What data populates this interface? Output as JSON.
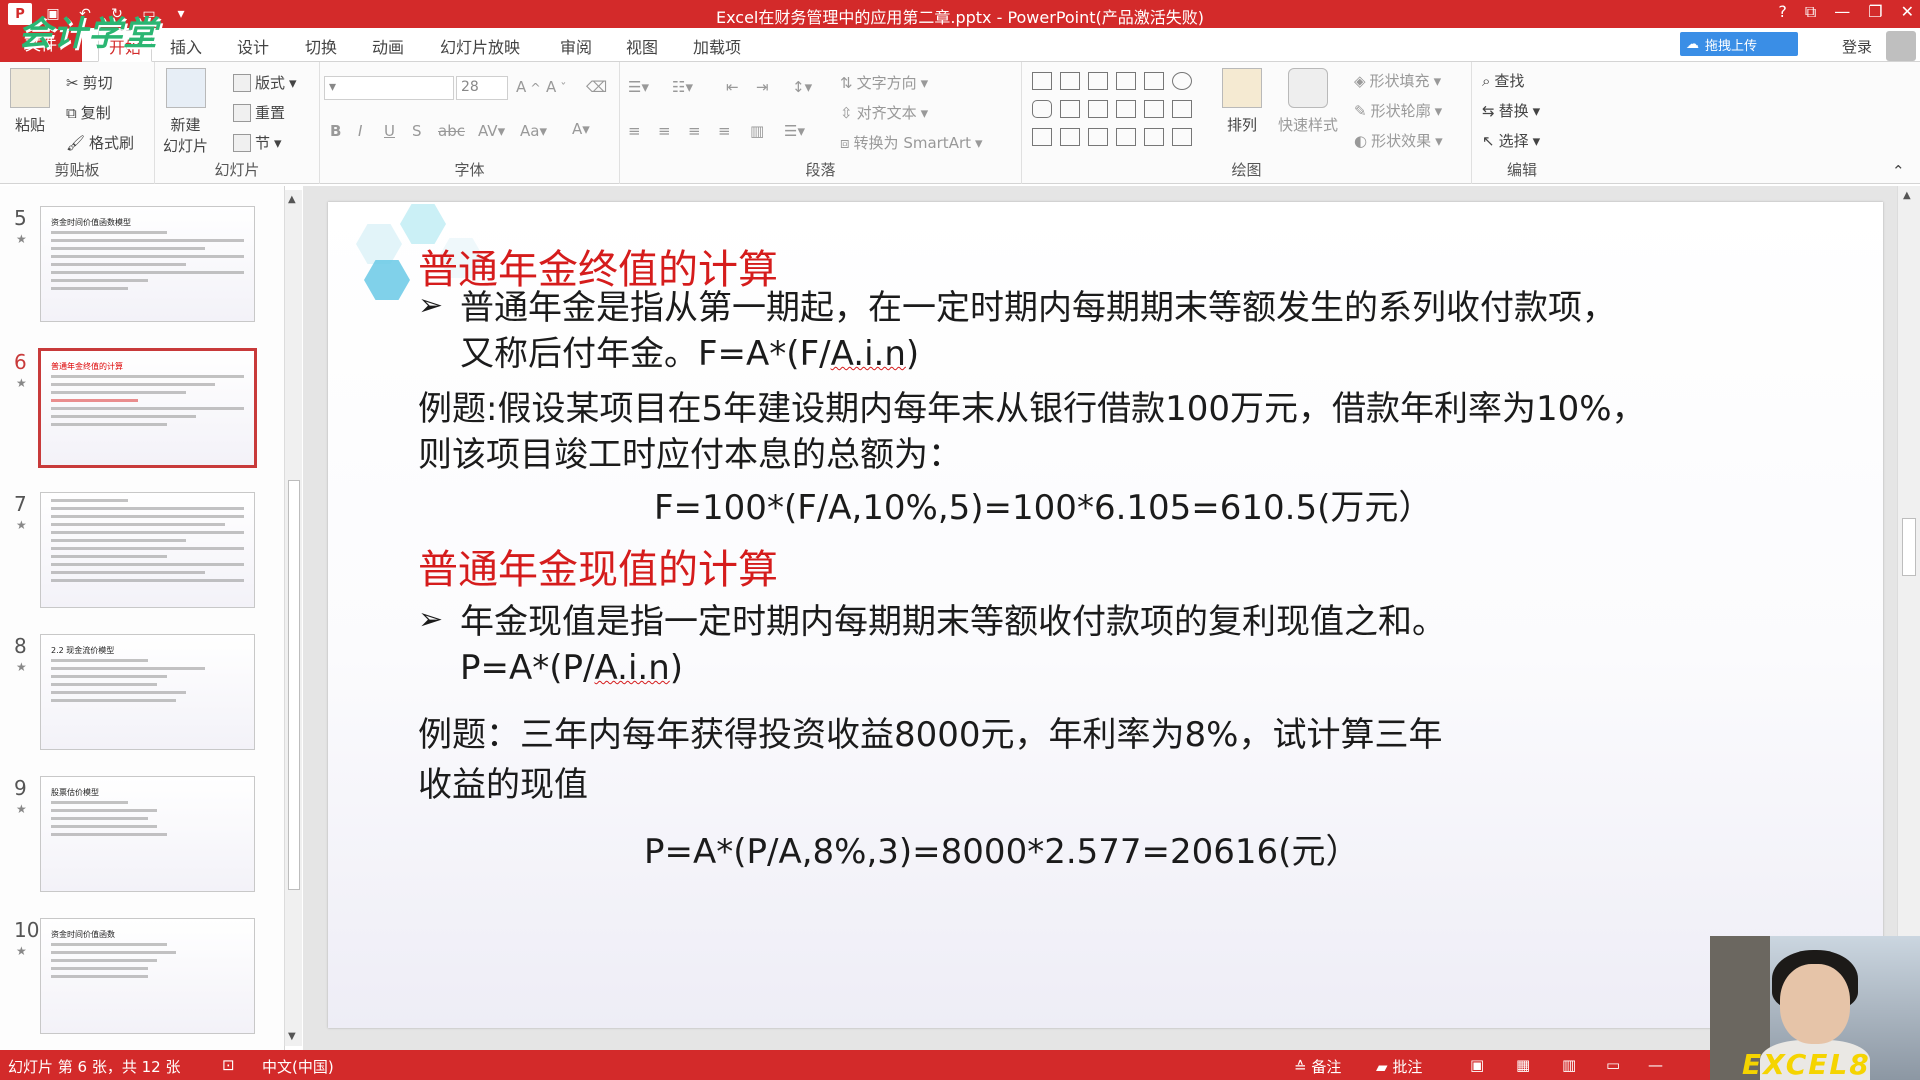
{
  "titlebar": {
    "title": "Excel在财务管理中的应用第二章.pptx - PowerPoint(产品激活失败)",
    "watermark": "会计学堂",
    "window_controls": [
      "?",
      "⧉",
      "—",
      "❐",
      "✕"
    ]
  },
  "tabs": {
    "file": "文件",
    "items": [
      "开始",
      "插入",
      "设计",
      "切换",
      "动画",
      "幻灯片放映",
      "审阅",
      "视图",
      "加载项"
    ],
    "active": "开始",
    "upload_button": "拖拽上传",
    "login": "登录"
  },
  "ribbon": {
    "clipboard": {
      "label": "剪贴板",
      "paste": "粘贴",
      "cut": "剪切",
      "copy": "复制",
      "format_painter": "格式刷"
    },
    "slides": {
      "label": "幻灯片",
      "new_slide": "新建\n幻灯片",
      "layout": "版式",
      "reset": "重置",
      "section": "节"
    },
    "font": {
      "label": "字体",
      "font_size": "28"
    },
    "paragraph": {
      "label": "段落",
      "text_direction": "文字方向",
      "align_text": "对齐文本",
      "convert_smartart": "转换为 SmartArt"
    },
    "drawing": {
      "label": "绘图",
      "arrange": "排列",
      "quick_styles": "快速样式",
      "shape_fill": "形状填充",
      "shape_outline": "形状轮廓",
      "shape_effects": "形状效果"
    },
    "editing": {
      "label": "编辑",
      "find": "查找",
      "replace": "替换",
      "select": "选择"
    }
  },
  "slide_panel": {
    "thumbnails": [
      {
        "number": "5",
        "title": "资金时间价值函数模型",
        "selected": false
      },
      {
        "number": "6",
        "title": "普通年金终值的计算",
        "selected": true
      },
      {
        "number": "7",
        "title": "",
        "selected": false
      },
      {
        "number": "8",
        "title": "2.2 现金流价模型",
        "selected": false
      },
      {
        "number": "9",
        "title": "股票估价模型",
        "selected": false
      },
      {
        "number": "10",
        "title": "资金时间价值函数",
        "selected": false
      }
    ]
  },
  "slide": {
    "heading1": "普通年金终值的计算",
    "bullet1_line1": "普通年金是指从第一期起，在一定时期内每期期末等额发生的系列收付款项，",
    "bullet1_line2_prefix": "又称后付年金。F=A*(F/",
    "bullet1_line2_squiggle": "A.i.n",
    "bullet1_line2_suffix": ")",
    "example1_line1": "例题:假设某项目在5年建设期内每年末从银行借款100万元，借款年利率为10%，",
    "example1_line2": "则该项目竣工时应付本息的总额为：",
    "formula1": "F=100*(F/A,10%,5)=100*6.105=610.5(万元）",
    "heading2": "普通年金现值的计算",
    "bullet2_line1": "年金现值是指一定时期内每期期末等额收付款项的复利现值之和。",
    "bullet2_line2_prefix": "P=A*(P/",
    "bullet2_line2_squiggle": "A.i.n",
    "bullet2_line2_suffix": ")",
    "example2_line1": "例题：三年内每年获得投资收益8000元，年利率为8%，试计算三年",
    "example2_line2": "收益的现值",
    "formula2": "P=A*(P/A,8%,3)=8000*2.577=20616(元）",
    "bullet_glyph": "➢"
  },
  "statusbar": {
    "slide_info": "幻灯片 第 6 张，共 12 张",
    "language": "中文(中国)",
    "notes": "备注",
    "comments": "批注"
  },
  "webcam": {
    "brand": "EXCEL8"
  },
  "colors": {
    "accent": "#d32a2a",
    "heading": "#d51c1c"
  }
}
